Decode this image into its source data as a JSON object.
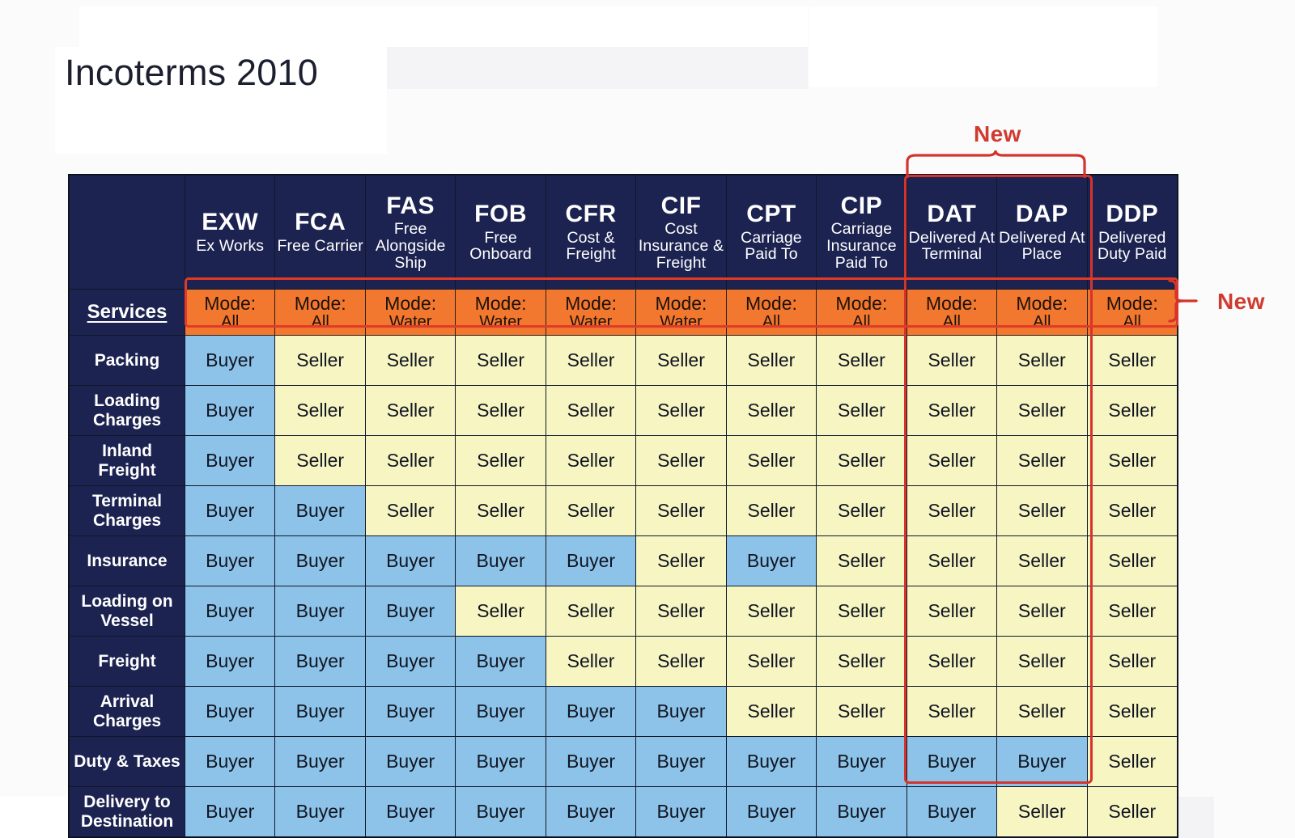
{
  "title": "Incoterms 2010",
  "annotations": {
    "new_top": "New",
    "new_right": "New"
  },
  "table": {
    "services_header": "Services",
    "mode_label": "Mode:",
    "columns": [
      {
        "code": "EXW",
        "name": "Ex Works",
        "mode": "All"
      },
      {
        "code": "FCA",
        "name": "Free Carrier",
        "mode": "All"
      },
      {
        "code": "FAS",
        "name": "Free Alongside Ship",
        "mode": "Water"
      },
      {
        "code": "FOB",
        "name": "Free Onboard",
        "mode": "Water"
      },
      {
        "code": "CFR",
        "name": "Cost & Freight",
        "mode": "Water"
      },
      {
        "code": "CIF",
        "name": "Cost Insurance & Freight",
        "mode": "Water"
      },
      {
        "code": "CPT",
        "name": "Carriage Paid To",
        "mode": "All"
      },
      {
        "code": "CIP",
        "name": "Carriage Insurance Paid To",
        "mode": "All"
      },
      {
        "code": "DAT",
        "name": "Delivered At Terminal",
        "mode": "All"
      },
      {
        "code": "DAP",
        "name": "Delivered At Place",
        "mode": "All"
      },
      {
        "code": "DDP",
        "name": "Delivered Duty Paid",
        "mode": "All"
      }
    ],
    "rows": [
      {
        "service": "Packing",
        "values": [
          "Buyer",
          "Seller",
          "Seller",
          "Seller",
          "Seller",
          "Seller",
          "Seller",
          "Seller",
          "Seller",
          "Seller",
          "Seller"
        ]
      },
      {
        "service": "Loading Charges",
        "values": [
          "Buyer",
          "Seller",
          "Seller",
          "Seller",
          "Seller",
          "Seller",
          "Seller",
          "Seller",
          "Seller",
          "Seller",
          "Seller"
        ]
      },
      {
        "service": "Inland Freight",
        "values": [
          "Buyer",
          "Seller",
          "Seller",
          "Seller",
          "Seller",
          "Seller",
          "Seller",
          "Seller",
          "Seller",
          "Seller",
          "Seller"
        ]
      },
      {
        "service": "Terminal Charges",
        "values": [
          "Buyer",
          "Buyer",
          "Seller",
          "Seller",
          "Seller",
          "Seller",
          "Seller",
          "Seller",
          "Seller",
          "Seller",
          "Seller"
        ]
      },
      {
        "service": "Insurance",
        "values": [
          "Buyer",
          "Buyer",
          "Buyer",
          "Buyer",
          "Buyer",
          "Seller",
          "Buyer",
          "Seller",
          "Seller",
          "Seller",
          "Seller"
        ]
      },
      {
        "service": "Loading on Vessel",
        "values": [
          "Buyer",
          "Buyer",
          "Buyer",
          "Seller",
          "Seller",
          "Seller",
          "Seller",
          "Seller",
          "Seller",
          "Seller",
          "Seller"
        ]
      },
      {
        "service": "Freight",
        "values": [
          "Buyer",
          "Buyer",
          "Buyer",
          "Buyer",
          "Seller",
          "Seller",
          "Seller",
          "Seller",
          "Seller",
          "Seller",
          "Seller"
        ]
      },
      {
        "service": "Arrival Charges",
        "values": [
          "Buyer",
          "Buyer",
          "Buyer",
          "Buyer",
          "Buyer",
          "Buyer",
          "Seller",
          "Seller",
          "Seller",
          "Seller",
          "Seller"
        ]
      },
      {
        "service": "Duty & Taxes",
        "values": [
          "Buyer",
          "Buyer",
          "Buyer",
          "Buyer",
          "Buyer",
          "Buyer",
          "Buyer",
          "Buyer",
          "Buyer",
          "Buyer",
          "Seller"
        ]
      },
      {
        "service": "Delivery to Destination",
        "values": [
          "Buyer",
          "Buyer",
          "Buyer",
          "Buyer",
          "Buyer",
          "Buyer",
          "Buyer",
          "Buyer",
          "Buyer",
          "Seller",
          "Seller"
        ]
      }
    ]
  },
  "colors": {
    "header_navy": "#1c2351",
    "mode_orange": "#f2772f",
    "buyer_blue": "#8dc3e8",
    "seller_yellow": "#f7f5c2",
    "annotation_red": "#cf3b30"
  }
}
